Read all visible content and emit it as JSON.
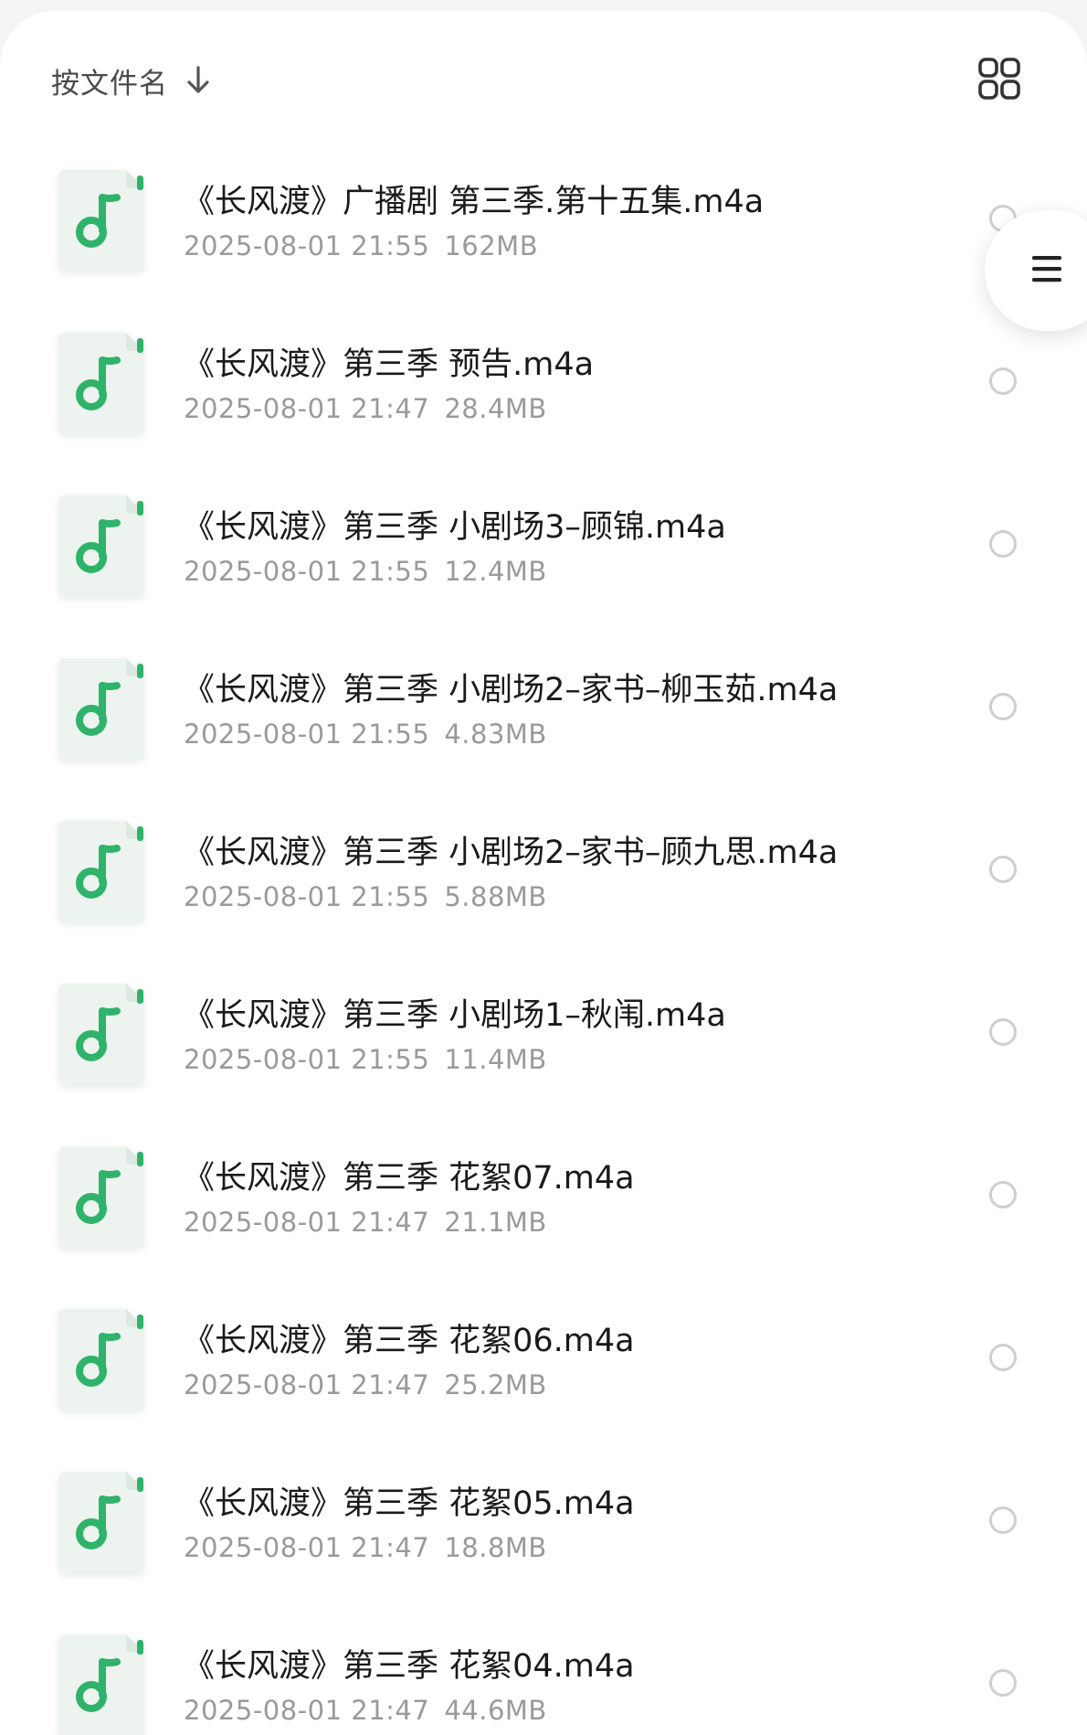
{
  "header": {
    "sort_label": "按文件名",
    "sort_icon": "arrow-down-icon",
    "view_toggle_icon": "grid-view-icon"
  },
  "floating_menu": {
    "icon": "menu-icon"
  },
  "colors": {
    "accent_green": "#2fb36a",
    "thumb_bg": "#edf4ef"
  },
  "files": [
    {
      "name": "《长风渡》广播剧 第三季.第十五集.m4a",
      "date": "2025-08-01 21:55",
      "size": "162MB"
    },
    {
      "name": "《长风渡》第三季 预告.m4a",
      "date": "2025-08-01 21:47",
      "size": "28.4MB"
    },
    {
      "name": "《长风渡》第三季 小剧场3–顾锦.m4a",
      "date": "2025-08-01 21:55",
      "size": "12.4MB"
    },
    {
      "name": "《长风渡》第三季 小剧场2–家书–柳玉茹.m4a",
      "date": "2025-08-01 21:55",
      "size": "4.83MB"
    },
    {
      "name": "《长风渡》第三季 小剧场2–家书–顾九思.m4a",
      "date": "2025-08-01 21:55",
      "size": "5.88MB"
    },
    {
      "name": "《长风渡》第三季 小剧场1–秋闱.m4a",
      "date": "2025-08-01 21:55",
      "size": "11.4MB"
    },
    {
      "name": "《长风渡》第三季 花絮07.m4a",
      "date": "2025-08-01 21:47",
      "size": "21.1MB"
    },
    {
      "name": "《长风渡》第三季 花絮06.m4a",
      "date": "2025-08-01 21:47",
      "size": "25.2MB"
    },
    {
      "name": "《长风渡》第三季 花絮05.m4a",
      "date": "2025-08-01 21:47",
      "size": "18.8MB"
    },
    {
      "name": "《长风渡》第三季 花絮04.m4a",
      "date": "2025-08-01 21:47",
      "size": "44.6MB"
    }
  ]
}
